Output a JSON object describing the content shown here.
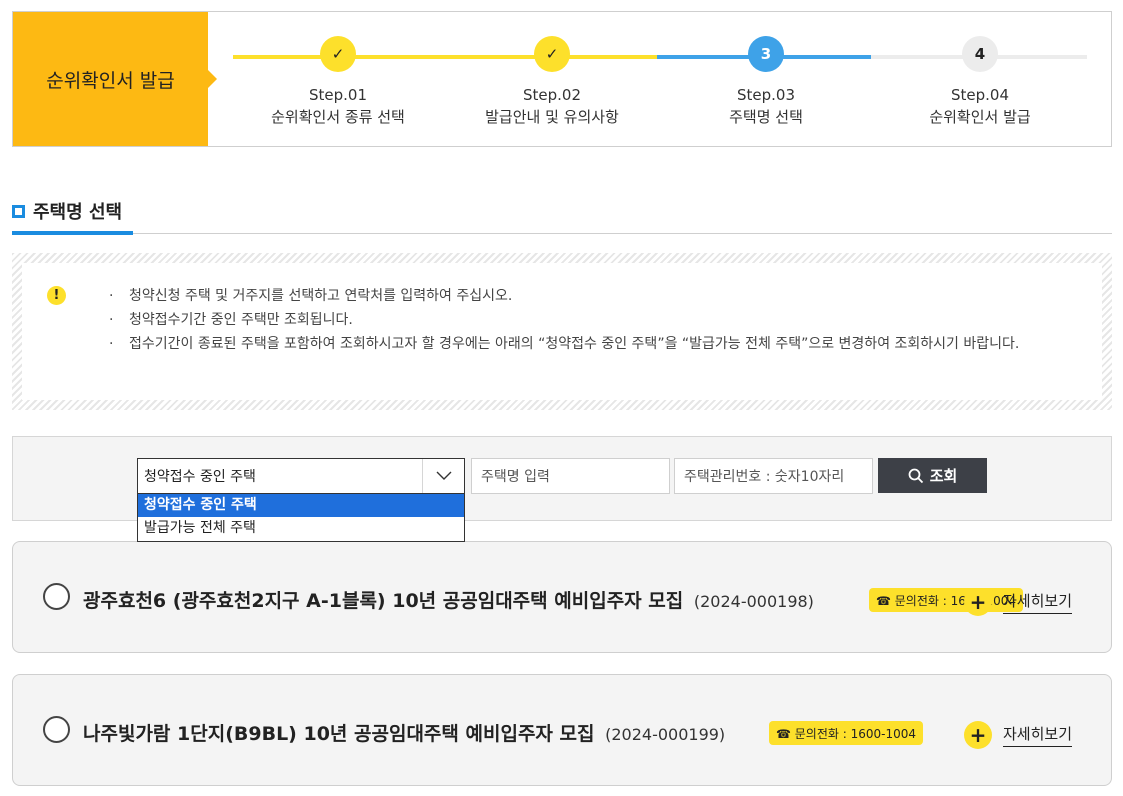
{
  "steps": {
    "title": "순위확인서 발급",
    "items": [
      {
        "num": "Step.01",
        "label": "순위확인서 종류 선택",
        "marker": "✓",
        "state": "done"
      },
      {
        "num": "Step.02",
        "label": "발급안내 및 유의사항",
        "marker": "✓",
        "state": "done"
      },
      {
        "num": "Step.03",
        "label": "주택명 선택",
        "marker": "3",
        "state": "active"
      },
      {
        "num": "Step.04",
        "label": "순위확인서 발급",
        "marker": "4",
        "state": "todo"
      }
    ]
  },
  "section": {
    "title": "주택명 선택"
  },
  "notice": {
    "icon": "exclamation-icon",
    "items": [
      "청약신청 주택 및 거주지를 선택하고 연락처를 입력하여 주십시오.",
      "청약접수기간 중인 주택만 조회됩니다.",
      "접수기간이 종료된 주택을 포함하여 조회하시고자 할 경우에는 아래의 “청약접수 중인 주택”을 “발급가능 전체 주택”으로 변경하여 조회하시기 바랍니다."
    ]
  },
  "search": {
    "select_value": "청약접수 중인 주택",
    "options": [
      "청약접수 중인 주택",
      "발급가능 전체 주택"
    ],
    "name_placeholder": "주택명 입력",
    "id_placeholder": "주택관리번호 : 숫자10자리",
    "button_label": "조회"
  },
  "housing": [
    {
      "title": "광주효천6 (광주효천2지구 A-1블록) 10년 공공임대주택 예비입주자 모집",
      "code": "(2024-000198)",
      "phone": "☎ 문의전화 : 1600-1004",
      "detail_label": "자세히보기"
    },
    {
      "title": "나주빛가람 1단지(B9BL) 10년 공공임대주택 예비입주자 모집",
      "code": "(2024-000199)",
      "phone": "☎ 문의전화 : 1600-1004",
      "detail_label": "자세히보기"
    }
  ],
  "colors": {
    "accent_yellow": "#fdb913",
    "step_yellow": "#fde02b",
    "step_blue": "#3ea2e8",
    "select_blue": "#1f6fdc"
  }
}
